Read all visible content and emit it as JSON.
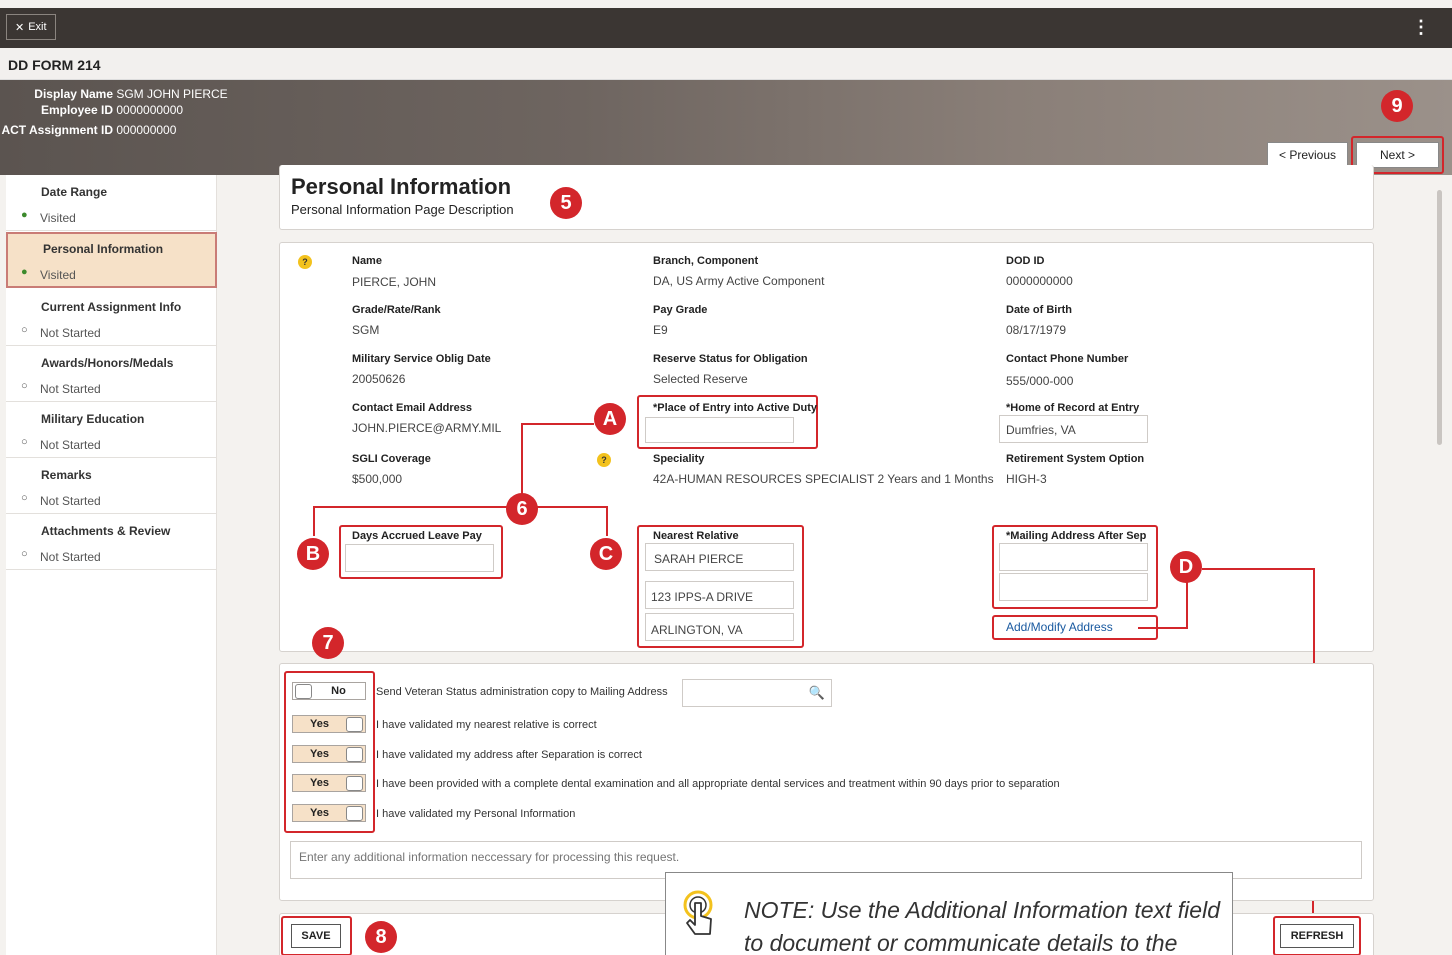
{
  "topbar": {
    "exit_label": "Exit",
    "menu_glyph": "⋮"
  },
  "form_title": "DD FORM 214",
  "banner": {
    "display_name_label": "Display Name",
    "display_name": "SGM JOHN PIERCE",
    "employee_id_label": "Employee ID",
    "employee_id": "0000000000",
    "act_assignment_label": "ACT Assignment ID",
    "act_assignment_id": "000000000",
    "prev_label": "< Previous",
    "next_label": "Next >"
  },
  "sidebar": {
    "items": [
      {
        "title": "Date Range",
        "status": "Visited"
      },
      {
        "title": "Personal Information",
        "status": "Visited"
      },
      {
        "title": "Current Assignment Info",
        "status": "Not Started"
      },
      {
        "title": "Awards/Honors/Medals",
        "status": "Not Started"
      },
      {
        "title": "Military Education",
        "status": "Not Started"
      },
      {
        "title": "Remarks",
        "status": "Not Started"
      },
      {
        "title": "Attachments & Review",
        "status": "Not Started"
      }
    ]
  },
  "page": {
    "title": "Personal Information",
    "description": "Personal Information Page Description"
  },
  "fields": {
    "name_label": "Name",
    "name": "PIERCE, JOHN",
    "branch_label": "Branch, Component",
    "branch": "DA, US Army Active Component",
    "dodid_label": "DOD ID",
    "dodid": "0000000000",
    "grade_label": "Grade/Rate/Rank",
    "grade": "SGM",
    "paygrade_label": "Pay Grade",
    "paygrade": "E9",
    "dob_label": "Date of Birth",
    "dob": "08/17/1979",
    "oblig_label": "Military Service Oblig Date",
    "oblig": "20050626",
    "reserve_label": "Reserve Status for Obligation",
    "reserve": "Selected Reserve",
    "phone_label": "Contact Phone Number",
    "phone": "555/000-000",
    "email_label": "Contact Email Address",
    "email": "JOHN.PIERCE@ARMY.MIL",
    "entry_label": "*Place of Entry into Active Duty",
    "entry": "",
    "home_label": "*Home of Record at Entry",
    "home": "Dumfries, VA",
    "sgli_label": "SGLI Coverage",
    "sgli": "$500,000",
    "speciality_label": "Speciality",
    "speciality": "42A-HUMAN RESOURCES SPECIALIST 2 Years and 1 Months",
    "retire_label": "Retirement System Option",
    "retire": "HIGH-3",
    "leave_label": "Days Accrued Leave Pay",
    "leave": "",
    "relative_label": "Nearest Relative",
    "relative_name": "SARAH PIERCE",
    "relative_street": "123 IPPS-A DRIVE",
    "relative_city": "ARLINGTON, VA",
    "mailing_label": "*Mailing Address After Sep",
    "add_modify_label": "Add/Modify Address"
  },
  "toggles": [
    {
      "value": "No",
      "text": "Send Veteran Status administration copy to Mailing Address"
    },
    {
      "value": "Yes",
      "text": "I have validated my nearest relative is correct"
    },
    {
      "value": "Yes",
      "text": "I have validated my address after Separation is correct"
    },
    {
      "value": "Yes",
      "text": "I have been provided with a complete dental examination and all appropriate dental services and treatment within 90 days prior to separation"
    },
    {
      "value": "Yes",
      "text": "I have validated my Personal Information"
    }
  ],
  "additional_info_placeholder": "Enter any additional information neccessary for processing this request.",
  "save_label": "SAVE",
  "refresh_label": "REFRESH",
  "note": {
    "line1": "NOTE: Use the Additional Information text field",
    "line2": "to document or communicate details to the"
  },
  "callouts": {
    "five": "5",
    "six": "6",
    "seven": "7",
    "eight": "8",
    "nine": "9",
    "a": "A",
    "b": "B",
    "c": "C",
    "d": "D"
  },
  "help_glyph": "?",
  "colors": {
    "accent_red": "#d3262b",
    "active_bg": "#f6e1c8",
    "link": "#1a5aa0",
    "dot_visited": "#3c8a2c"
  }
}
